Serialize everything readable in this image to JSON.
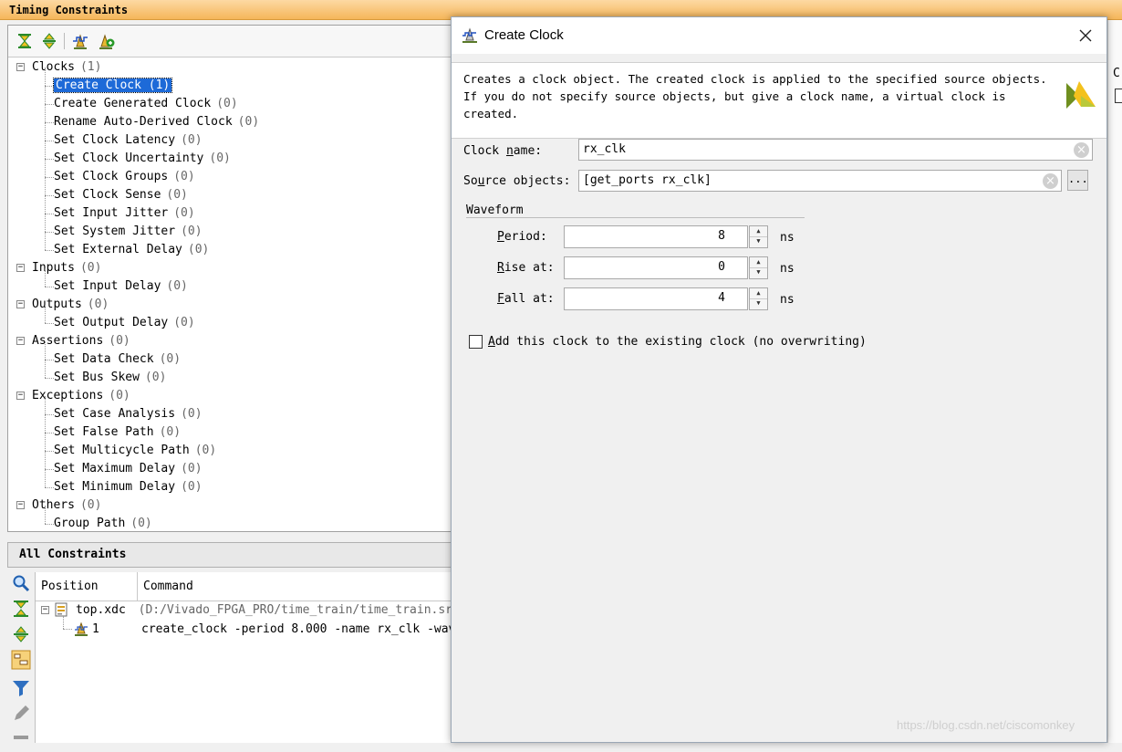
{
  "panel": {
    "title": "Timing Constraints"
  },
  "tree": [
    {
      "label": "Clocks",
      "count": "(1)",
      "level": 0,
      "expanded": true
    },
    {
      "label": "Create Clock",
      "count": "(1)",
      "level": 1,
      "selected": true
    },
    {
      "label": "Create Generated Clock",
      "count": "(0)",
      "level": 1
    },
    {
      "label": "Rename Auto-Derived Clock",
      "count": "(0)",
      "level": 1
    },
    {
      "label": "Set Clock Latency",
      "count": "(0)",
      "level": 1
    },
    {
      "label": "Set Clock Uncertainty",
      "count": "(0)",
      "level": 1
    },
    {
      "label": "Set Clock Groups",
      "count": "(0)",
      "level": 1
    },
    {
      "label": "Set Clock Sense",
      "count": "(0)",
      "level": 1
    },
    {
      "label": "Set Input Jitter",
      "count": "(0)",
      "level": 1
    },
    {
      "label": "Set System Jitter",
      "count": "(0)",
      "level": 1
    },
    {
      "label": "Set External Delay",
      "count": "(0)",
      "level": 1
    },
    {
      "label": "Inputs",
      "count": "(0)",
      "level": 0,
      "expanded": true
    },
    {
      "label": "Set Input Delay",
      "count": "(0)",
      "level": 1
    },
    {
      "label": "Outputs",
      "count": "(0)",
      "level": 0,
      "expanded": true
    },
    {
      "label": "Set Output Delay",
      "count": "(0)",
      "level": 1
    },
    {
      "label": "Assertions",
      "count": "(0)",
      "level": 0,
      "expanded": true
    },
    {
      "label": "Set Data Check",
      "count": "(0)",
      "level": 1
    },
    {
      "label": "Set Bus Skew",
      "count": "(0)",
      "level": 1
    },
    {
      "label": "Exceptions",
      "count": "(0)",
      "level": 0,
      "expanded": true
    },
    {
      "label": "Set Case Analysis",
      "count": "(0)",
      "level": 1
    },
    {
      "label": "Set False Path",
      "count": "(0)",
      "level": 1
    },
    {
      "label": "Set Multicycle Path",
      "count": "(0)",
      "level": 1
    },
    {
      "label": "Set Maximum Delay",
      "count": "(0)",
      "level": 1
    },
    {
      "label": "Set Minimum Delay",
      "count": "(0)",
      "level": 1
    },
    {
      "label": "Others",
      "count": "(0)",
      "level": 0,
      "expanded": true
    },
    {
      "label": "Group Path",
      "count": "(0)",
      "level": 1
    }
  ],
  "all_constraints": {
    "title": "All Constraints",
    "columns": [
      "Position",
      "Command"
    ],
    "file_row": {
      "file": "top.xdc",
      "path": "(D:/Vivado_FPGA_PRO/time_train/time_train.srcs/"
    },
    "constraint_row": {
      "index": "1",
      "command": "create_clock -period 8.000 -name rx_clk -wavef"
    }
  },
  "dialog": {
    "title": "Create Clock",
    "description": "Creates a clock object. The created clock is applied to the specified source objects. If you do not specify source objects, but give a clock name, a virtual clock is created.",
    "clock_name_label": "Clock name:",
    "clock_name_value": "rx_clk",
    "source_objects_label": "Source objects:",
    "source_objects_value": "[get_ports rx_clk]",
    "browse_label": "...",
    "waveform_label": "Waveform",
    "period_label": "Period:",
    "period_value": "8",
    "rise_label": "Rise at:",
    "rise_value": "0",
    "fall_label": "Fall at:",
    "fall_value": "4",
    "unit": "ns",
    "checkbox_label": "Add this clock to the existing clock (no overwriting)",
    "checkbox_checked": false
  },
  "right_strip": {
    "text": "C"
  },
  "watermark": "https://blog.csdn.net/ciscomonkey"
}
